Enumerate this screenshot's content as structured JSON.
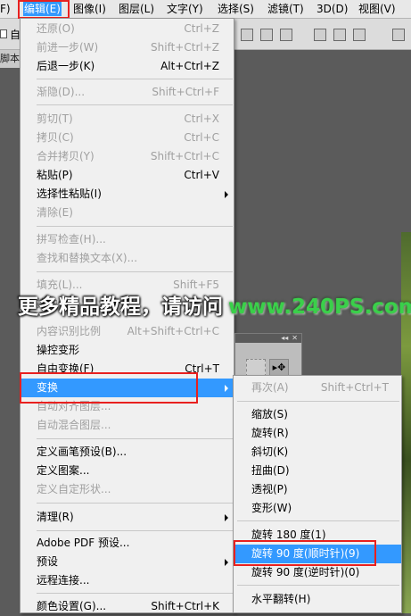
{
  "menubar": {
    "items": [
      {
        "label": "F)"
      },
      {
        "label": "编辑(E)"
      },
      {
        "label": "图像(I)"
      },
      {
        "label": "图层(L)"
      },
      {
        "label": "文字(Y)"
      },
      {
        "label": "选择(S)"
      },
      {
        "label": "滤镜(T)"
      },
      {
        "label": "3D(D)"
      },
      {
        "label": "视图(V)"
      }
    ]
  },
  "optbar": {
    "checkbox_label": "自",
    "tab_label": "脚本"
  },
  "edit_menu": {
    "items": [
      {
        "label": "还原(O)",
        "shortcut": "Ctrl+Z"
      },
      {
        "label": "前进一步(W)",
        "shortcut": "Shift+Ctrl+Z"
      },
      {
        "label": "后退一步(K)",
        "shortcut": "Alt+Ctrl+Z"
      },
      {
        "label": "渐隐(D)...",
        "shortcut": "Shift+Ctrl+F"
      },
      {
        "label": "剪切(T)",
        "shortcut": "Ctrl+X"
      },
      {
        "label": "拷贝(C)",
        "shortcut": "Ctrl+C"
      },
      {
        "label": "合并拷贝(Y)",
        "shortcut": "Shift+Ctrl+C"
      },
      {
        "label": "粘贴(P)",
        "shortcut": "Ctrl+V"
      },
      {
        "label": "选择性粘贴(I)",
        "shortcut": ""
      },
      {
        "label": "清除(E)",
        "shortcut": ""
      },
      {
        "label": "拼写检查(H)...",
        "shortcut": ""
      },
      {
        "label": "查找和替换文本(X)...",
        "shortcut": ""
      },
      {
        "label": "填充(L)...",
        "shortcut": "Shift+F5"
      },
      {
        "label": "描边(S)...",
        "shortcut": ""
      },
      {
        "label": "内容识别比例",
        "shortcut": "Alt+Shift+Ctrl+C"
      },
      {
        "label": "操控变形",
        "shortcut": ""
      },
      {
        "label": "自由变换(F)",
        "shortcut": "Ctrl+T"
      },
      {
        "label": "变换",
        "shortcut": ""
      },
      {
        "label": "自动对齐图层...",
        "shortcut": ""
      },
      {
        "label": "自动混合图层...",
        "shortcut": ""
      },
      {
        "label": "定义画笔预设(B)...",
        "shortcut": ""
      },
      {
        "label": "定义图案...",
        "shortcut": ""
      },
      {
        "label": "定义自定形状...",
        "shortcut": ""
      },
      {
        "label": "清理(R)",
        "shortcut": ""
      },
      {
        "label": "Adobe PDF 预设...",
        "shortcut": ""
      },
      {
        "label": "预设",
        "shortcut": ""
      },
      {
        "label": "远程连接...",
        "shortcut": ""
      },
      {
        "label": "颜色设置(G)...",
        "shortcut": "Shift+Ctrl+K"
      }
    ]
  },
  "transform_submenu": {
    "items": [
      {
        "label": "再次(A)",
        "shortcut": "Shift+Ctrl+T"
      },
      {
        "label": "缩放(S)",
        "shortcut": ""
      },
      {
        "label": "旋转(R)",
        "shortcut": ""
      },
      {
        "label": "斜切(K)",
        "shortcut": ""
      },
      {
        "label": "扭曲(D)",
        "shortcut": ""
      },
      {
        "label": "透视(P)",
        "shortcut": ""
      },
      {
        "label": "变形(W)",
        "shortcut": ""
      },
      {
        "label": "旋转 180 度(1)",
        "shortcut": ""
      },
      {
        "label": "旋转 90 度(顺时针)(9)",
        "shortcut": ""
      },
      {
        "label": "旋转 90 度(逆时针)(0)",
        "shortcut": ""
      },
      {
        "label": "水平翻转(H)",
        "shortcut": ""
      }
    ]
  },
  "panel": {
    "collapse_glyph": "◂◂",
    "close_glyph": "✕",
    "move_tool_glyph": "▸✥"
  },
  "watermark": {
    "cn": "更多精品教程，请访问",
    "url": "www.240PS.com"
  },
  "colors": {
    "highlight": "#3399ff",
    "annotation": "#e8201f",
    "disabled": "#a0a0a0"
  }
}
